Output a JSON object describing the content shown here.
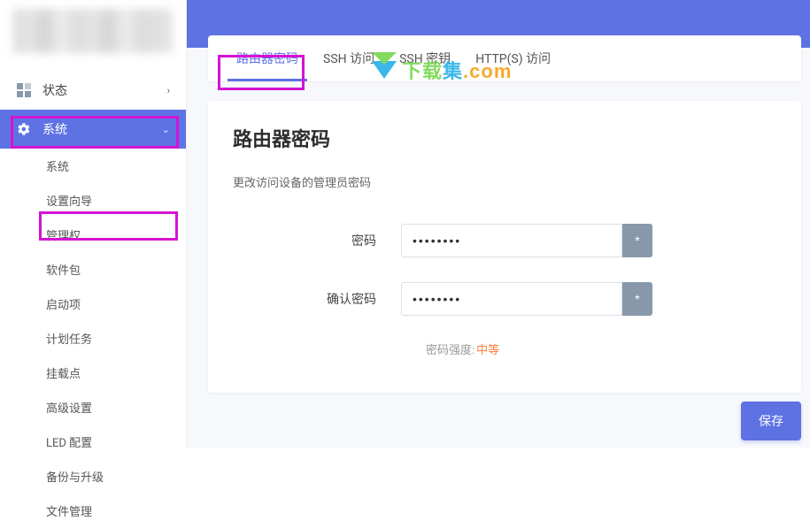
{
  "sidebar": {
    "status_label": "状态",
    "system_label": "系统",
    "submenu": [
      "系统",
      "设置向导",
      "管理权",
      "软件包",
      "启动项",
      "计划任务",
      "挂载点",
      "高级设置",
      "LED 配置",
      "备份与升级",
      "文件管理"
    ]
  },
  "tabs": {
    "router_password": "路由器密码",
    "ssh_access": "SSH 访问",
    "ssh_key": "SSH 密钥",
    "https_access": "HTTP(S) 访问"
  },
  "card": {
    "title": "路由器密码",
    "desc": "更改访问设备的管理员密码",
    "password_label": "密码",
    "confirm_label": "确认密码",
    "password_value": "••••••••",
    "confirm_value": "••••••••",
    "reveal_symbol": "*",
    "strength_label": "密码强度:",
    "strength_value": "中等"
  },
  "actions": {
    "save": "保存"
  },
  "watermark": {
    "brand_a": "下载",
    "brand_b": "集",
    "suffix": ".com"
  },
  "colors": {
    "accent": "#5e72e4",
    "highlight": "#d413d4",
    "warn": "#f5803e"
  }
}
